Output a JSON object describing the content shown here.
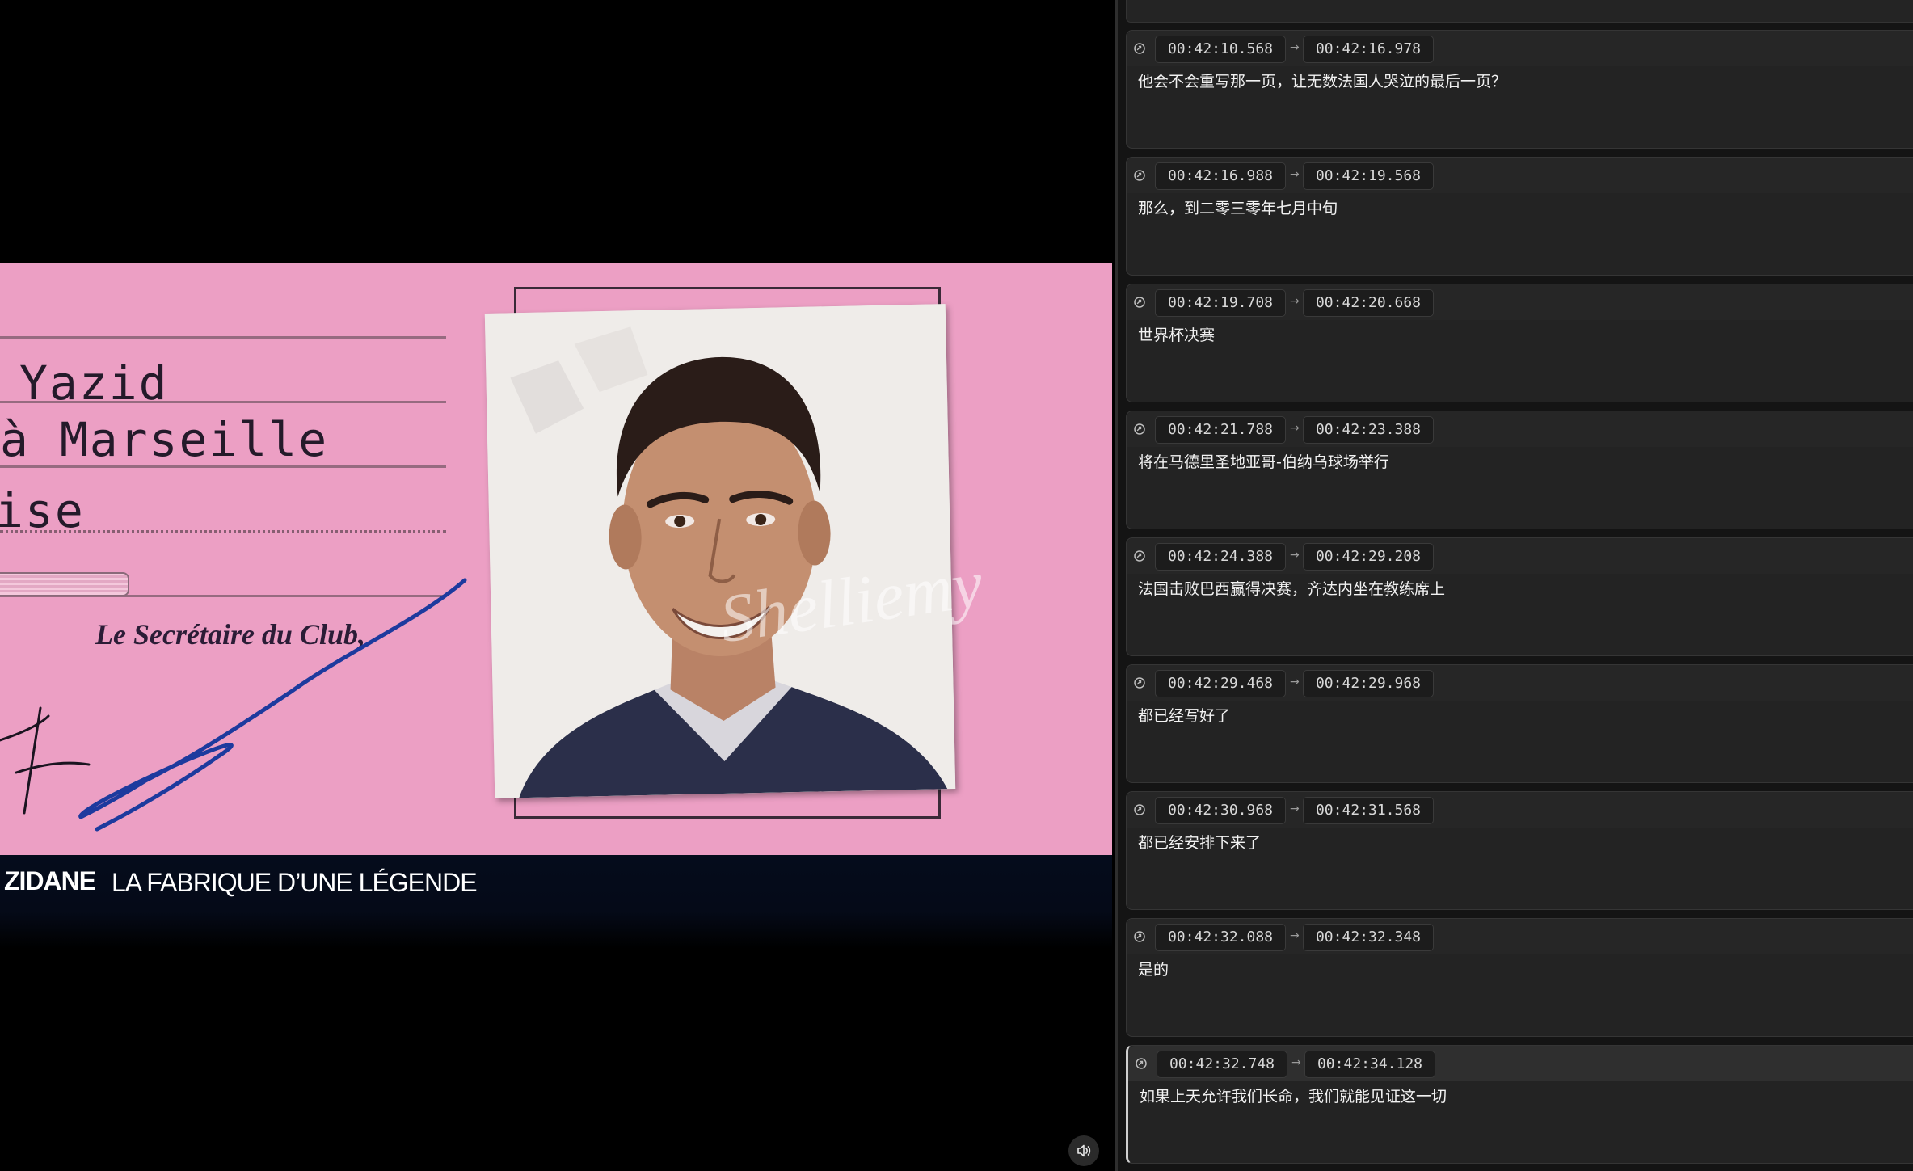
{
  "video": {
    "card": {
      "line1": "Yazid",
      "line2": "à Marseille",
      "line3": "ise",
      "signature_caption": "Le Secrétaire du Club,"
    },
    "watermark": "Shelliemy",
    "lower_third": {
      "brand": "ZIDANE",
      "title": "LA FABRIQUE D’UNE LÉGENDE"
    },
    "volume_icon": "speaker-icon"
  },
  "subtitles": [
    {
      "start": "00:42:10.568",
      "end": "00:42:16.978",
      "text": "他会不会重写那一页，让无数法国人哭泣的最后一页？"
    },
    {
      "start": "00:42:16.988",
      "end": "00:42:19.568",
      "text": "那么，到二零三零年七月中旬"
    },
    {
      "start": "00:42:19.708",
      "end": "00:42:20.668",
      "text": "世界杯决赛"
    },
    {
      "start": "00:42:21.788",
      "end": "00:42:23.388",
      "text": "将在马德里圣地亚哥-伯纳乌球场举行"
    },
    {
      "start": "00:42:24.388",
      "end": "00:42:29.208",
      "text": "法国击败巴西赢得决赛，齐达内坐在教练席上"
    },
    {
      "start": "00:42:29.468",
      "end": "00:42:29.968",
      "text": "都已经写好了"
    },
    {
      "start": "00:42:30.968",
      "end": "00:42:31.568",
      "text": "都已经安排下来了"
    },
    {
      "start": "00:42:32.088",
      "end": "00:42:32.348",
      "text": "是的"
    },
    {
      "start": "00:42:32.748",
      "end": "00:42:34.128",
      "text": "如果上天允许我们长命，我们就能见证这一切"
    }
  ],
  "arrow_glyph": "→",
  "colors": {
    "card_pink": "#ec9fc4",
    "ink_blue": "#1d3a9e",
    "panel_bg": "#141414",
    "entry_bg": "#232323"
  }
}
